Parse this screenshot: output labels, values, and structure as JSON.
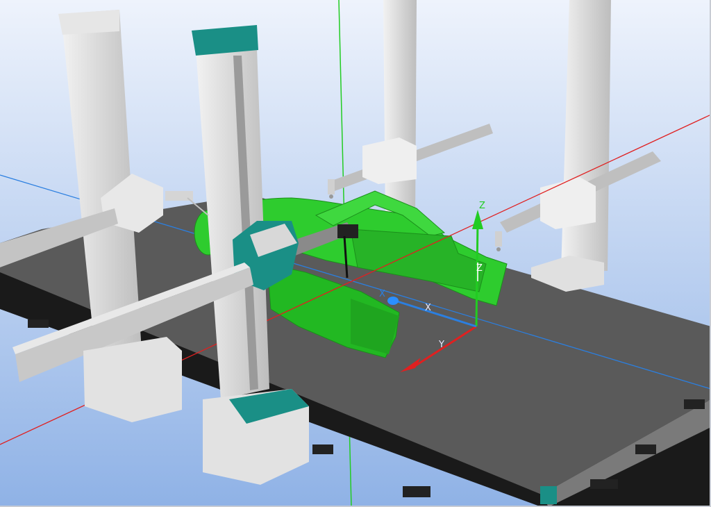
{
  "viewport": {
    "name": "3d-graphics-viewport",
    "background_top": "#eef3fc",
    "background_bottom": "#8fb2e6"
  },
  "world_axes": {
    "x_color": "#e02020",
    "y_color": "#2b7fe0",
    "z_color": "#22cc22"
  },
  "part": {
    "name": "car-body-model",
    "color": "#2ecc2e"
  },
  "gantry": {
    "upright_color": "#d9d9d9",
    "cap_color": "#1a8f86",
    "table_color": "#555555"
  },
  "frames": {
    "workobject": {
      "x_label": "X",
      "y_label": "Y",
      "z_label": "Z"
    },
    "tool": {
      "x_label": "X",
      "z_label": "Z"
    }
  }
}
